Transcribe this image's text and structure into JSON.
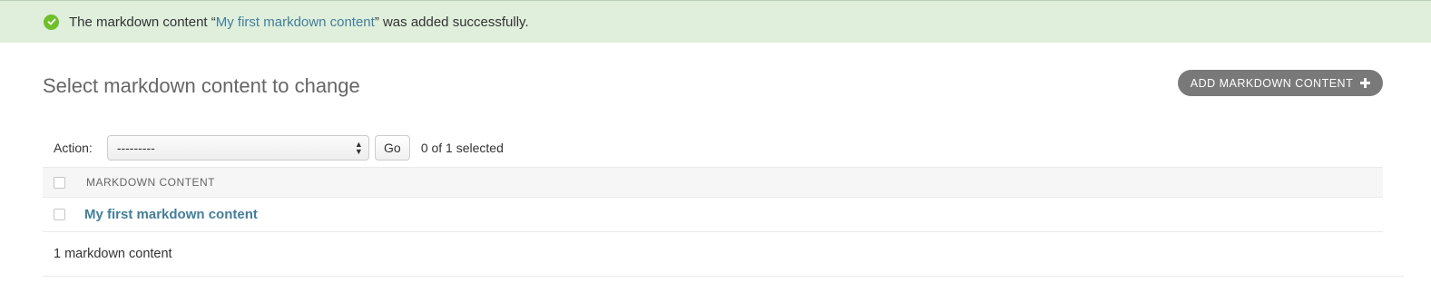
{
  "message": {
    "prefix": "The markdown content “",
    "link_text": "My first markdown content",
    "suffix": "” was added successfully.",
    "icon": "check-circle-icon",
    "color": "#70bf2b"
  },
  "page": {
    "title": "Select markdown content to change"
  },
  "toolbar": {
    "add_label": "ADD MARKDOWN CONTENT",
    "add_icon": "plus-icon"
  },
  "actions": {
    "label": "Action:",
    "selected_value": "---------",
    "go_label": "Go",
    "selected_count": "0 of 1 selected"
  },
  "table": {
    "headers": [
      "MARKDOWN CONTENT"
    ],
    "rows": [
      {
        "title": "My first markdown content"
      }
    ]
  },
  "paginator": {
    "count_text": "1 markdown content"
  }
}
